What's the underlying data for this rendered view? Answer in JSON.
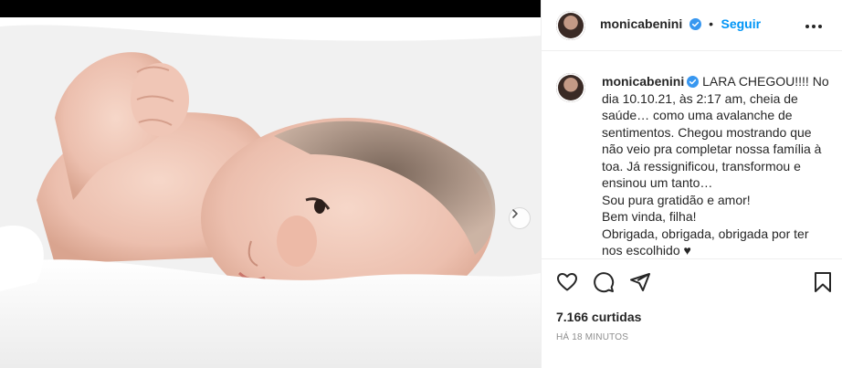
{
  "post": {
    "username": "monicabenini",
    "follow_label": "Seguir",
    "dot": "•",
    "caption_lines": [
      "LARA CHEGOU!!!! No dia 10.10.21, às 2:17 am, cheia de saúde… como uma avalanche de sentimentos. Chegou mostrando que não veio pra completar nossa família à toa. Já ressignificou, transformou e ensinou um tanto…",
      "Sou pura gratidão e amor!",
      "Bem vinda, filha!",
      "Obrigada, obrigada, obrigada por ter nos escolhido ♥"
    ],
    "likes": "7.166 curtidas",
    "time": "HÁ 18 MINUTOS"
  },
  "icons": {
    "verified": "verified-badge-icon",
    "more": "more-options-icon",
    "like": "heart-icon",
    "comment": "comment-icon",
    "share": "share-icon",
    "save": "bookmark-icon",
    "next": "chevron-right-icon"
  },
  "colors": {
    "accent": "#0095f6",
    "text": "#262626",
    "muted": "#8e8e8e",
    "border": "#efefef"
  }
}
